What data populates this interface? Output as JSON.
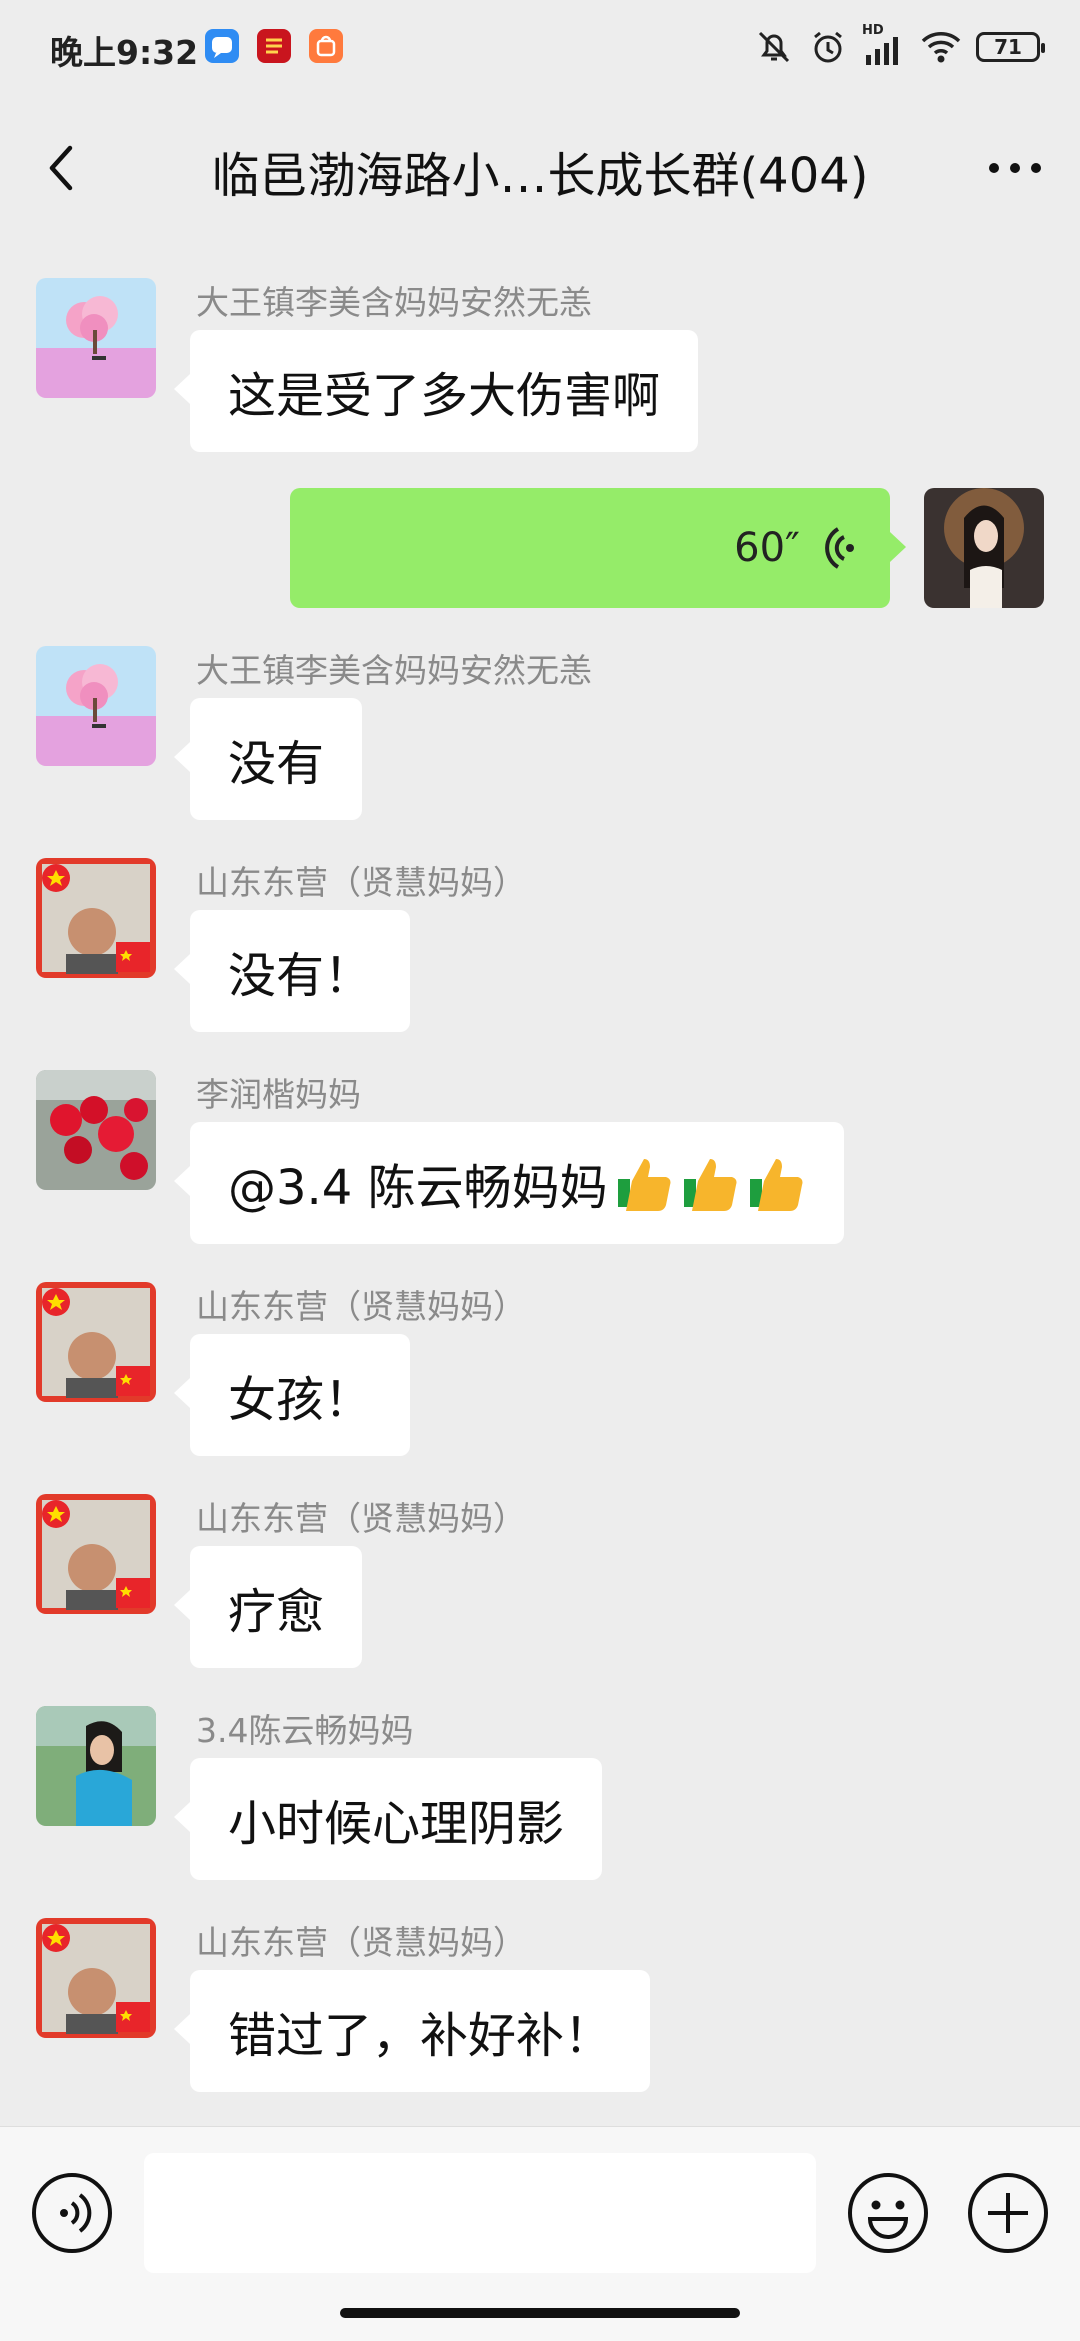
{
  "status_bar": {
    "time": "晚上9:32",
    "battery": "71",
    "network_badge": "HD",
    "icons": [
      "mute-bell-icon",
      "alarm-icon",
      "signal-icon",
      "wifi-icon",
      "battery-icon"
    ]
  },
  "header": {
    "title": "临邑渤海路小…长成长群(404)"
  },
  "messages": [
    {
      "sender": "大王镇李美含妈妈安然无恙",
      "text": "这是受了多大伤害啊"
    },
    {
      "self": true,
      "voice_duration": "60″"
    },
    {
      "sender": "大王镇李美含妈妈安然无恙",
      "text": "没有"
    },
    {
      "sender": "山东东营（贤慧妈妈）",
      "text": "没有！"
    },
    {
      "sender": "李润楷妈妈",
      "text": "@3.4 陈云畅妈妈 "
    },
    {
      "sender": "山东东营（贤慧妈妈）",
      "text": "女孩！"
    },
    {
      "sender": "山东东营（贤慧妈妈）",
      "text": "疗愈"
    },
    {
      "sender": "3.4陈云畅妈妈",
      "text": "小时候心理阴影"
    },
    {
      "sender": "山东东营（贤慧妈妈）",
      "text": "错过了，补好补！"
    }
  ],
  "input_bar": {
    "placeholder": ""
  },
  "colors": {
    "background": "#ededed",
    "self_bubble": "#95ec69",
    "other_bubble": "#ffffff"
  }
}
